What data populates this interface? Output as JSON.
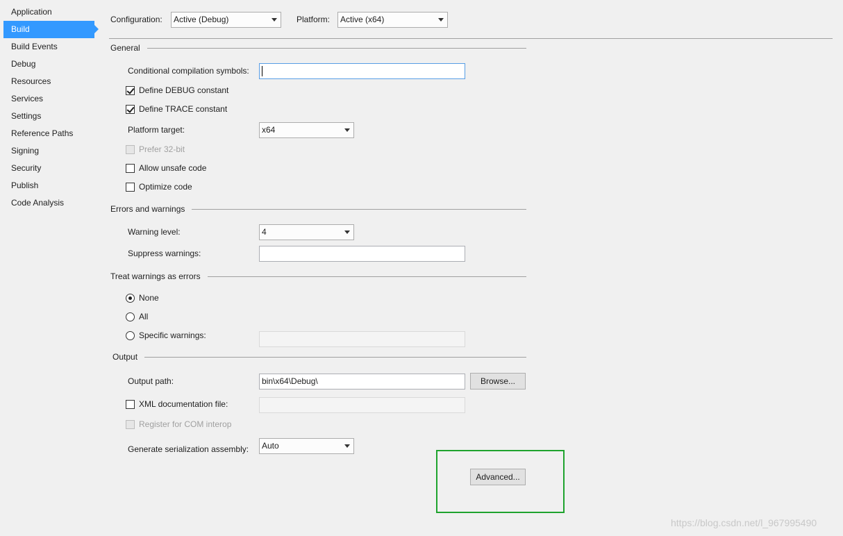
{
  "sidebar": {
    "items": [
      {
        "label": "Application"
      },
      {
        "label": "Build"
      },
      {
        "label": "Build Events"
      },
      {
        "label": "Debug"
      },
      {
        "label": "Resources"
      },
      {
        "label": "Services"
      },
      {
        "label": "Settings"
      },
      {
        "label": "Reference Paths"
      },
      {
        "label": "Signing"
      },
      {
        "label": "Security"
      },
      {
        "label": "Publish"
      },
      {
        "label": "Code Analysis"
      }
    ],
    "active": "Build",
    "active_color": "#3399ff"
  },
  "toolbar": {
    "configuration_label": "Configuration:",
    "configuration_value": "Active (Debug)",
    "platform_label": "Platform:",
    "platform_value": "Active (x64)"
  },
  "general": {
    "heading": "General",
    "conditional_symbols_label": "Conditional compilation symbols:",
    "conditional_symbols_value": "",
    "define_debug_label": "Define DEBUG constant",
    "define_debug_checked": true,
    "define_trace_label": "Define TRACE constant",
    "define_trace_checked": true,
    "platform_target_label": "Platform target:",
    "platform_target_value": "x64",
    "prefer32_label": "Prefer 32-bit",
    "prefer32_checked": false,
    "unsafe_label": "Allow unsafe code",
    "unsafe_checked": false,
    "optimize_label": "Optimize code",
    "optimize_checked": false
  },
  "errors": {
    "heading": "Errors and warnings",
    "warning_level_label": "Warning level:",
    "warning_level_value": "4",
    "suppress_label": "Suppress warnings:",
    "suppress_value": ""
  },
  "treat_warnings": {
    "heading": "Treat warnings as errors",
    "options": [
      {
        "label": "None",
        "checked": true
      },
      {
        "label": "All",
        "checked": false
      },
      {
        "label": "Specific warnings:",
        "checked": false
      }
    ],
    "specific_value": ""
  },
  "output": {
    "heading": "Output",
    "path_label": "Output path:",
    "path_value": "bin\\x64\\Debug\\",
    "browse_label": "Browse...",
    "xml_doc_label": "XML documentation file:",
    "xml_doc_checked": false,
    "xml_doc_value": "",
    "com_interop_label": "Register for COM interop",
    "com_interop_checked": false,
    "serialization_label": "Generate serialization assembly:",
    "serialization_value": "Auto",
    "advanced_label": "Advanced..."
  },
  "annotation": {
    "highlight_color": "#1ea32d"
  },
  "watermark": "https://blog.csdn.net/l_967995490"
}
